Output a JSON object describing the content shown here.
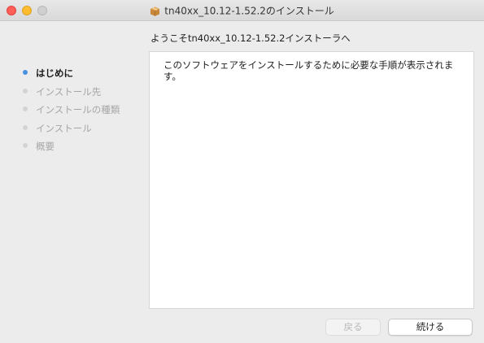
{
  "window": {
    "title": "tn40xx_10.12-1.52.2のインストール",
    "title_icon": "package-box-icon"
  },
  "installer": {
    "subtitle": "ようこそtn40xx_10.12-1.52.2インストーラへ",
    "steps": [
      {
        "label": "はじめに",
        "active": true
      },
      {
        "label": "インストール先",
        "active": false
      },
      {
        "label": "インストールの種類",
        "active": false
      },
      {
        "label": "インストール",
        "active": false
      },
      {
        "label": "概要",
        "active": false
      }
    ],
    "body_text": "このソフトウェアをインストールするために必要な手順が表示されます。"
  },
  "buttons": {
    "back_label": "戻る",
    "back_enabled": false,
    "continue_label": "続ける"
  },
  "colors": {
    "active_step_dot": "#4a90e2",
    "close": "#ff5f57",
    "minimize": "#febc2e"
  }
}
